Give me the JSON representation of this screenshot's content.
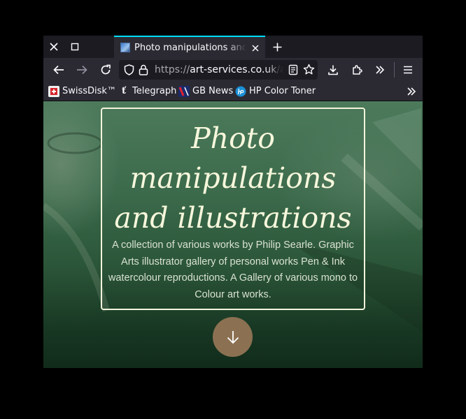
{
  "browser": {
    "tab": {
      "title": "Photo manipulations and illustrations"
    },
    "url": {
      "scheme": "https://",
      "host": "art-services.co.uk",
      "path": "/albu"
    },
    "bookmarks": [
      {
        "label": "SwissDisk™",
        "icon": "swissdisk-favicon"
      },
      {
        "label": "Telegraph",
        "icon": "telegraph-favicon"
      },
      {
        "label": "GB News",
        "icon": "gbnews-favicon"
      },
      {
        "label": "HP Color Toner",
        "icon": "hp-favicon"
      }
    ],
    "accent_color": "#00ddff"
  },
  "page": {
    "hero": {
      "title": "Photo manipulations and illustrations",
      "description": "A collection of various works by Philip Searle. Graphic Arts illustrator gallery of personal works Pen & Ink watercolour reproductions. A Gallery of various mono to Colour art works.",
      "scroll_button_color": "#8b7152"
    }
  }
}
